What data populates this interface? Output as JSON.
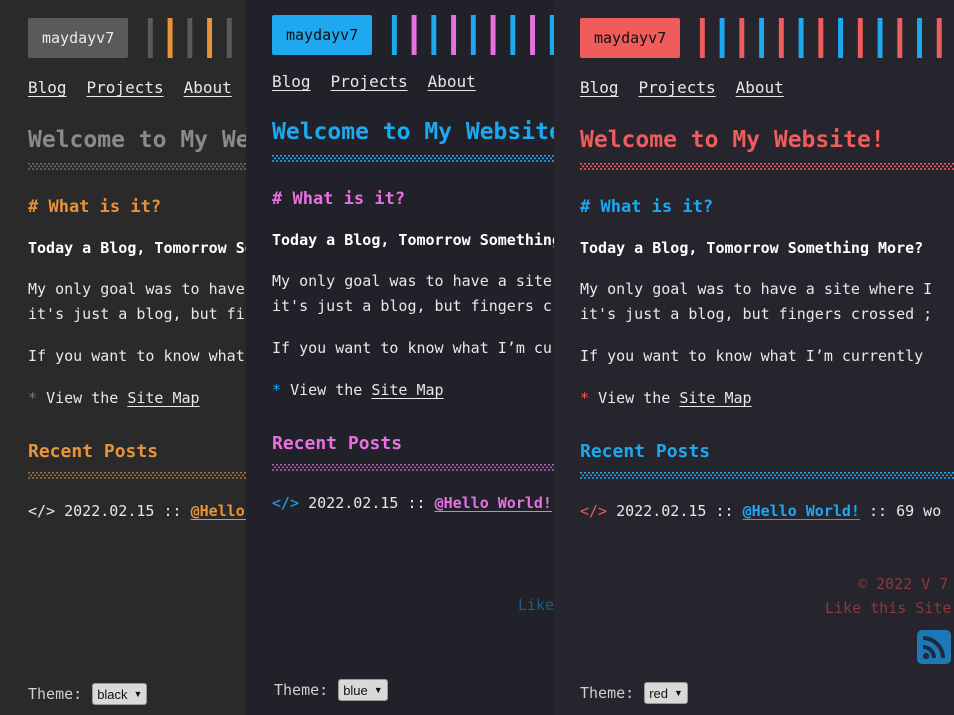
{
  "brand": "maydayv7",
  "nav": [
    "Blog",
    "Projects",
    "About"
  ],
  "welcome": "Welcome to My Website!",
  "section_heading": "# What is it?",
  "tagline": "Today a Blog, Tomorrow Something More?",
  "para_line1": "My only goal was to have a site where I",
  "para_line2": "it's just a blog, but fingers crossed ;",
  "para2": "If you want to know what I’m currently",
  "sitemap_prefix": "View the",
  "sitemap_link": "Site Map",
  "recent_posts": "Recent Posts",
  "post": {
    "icon": "</>",
    "date": "2022.02.15",
    "sep": "::",
    "link": "@Hello World!",
    "sep2": "::",
    "meta": "69 wo"
  },
  "footer": {
    "copyright": "© 2022 V 7",
    "like": "Like this Site"
  },
  "theme_label": "Theme:",
  "themes": [
    {
      "name": "black",
      "accent": "#e8933a",
      "title_color": "#8a8a8a",
      "logo_bg": "#5a5a5a",
      "logo_fg": "#eaeaea",
      "stripes": [
        "#5a5a5a",
        "#e8933a"
      ]
    },
    {
      "name": "blue",
      "accent": "#e870e0",
      "title_color": "#1ea8f0",
      "logo_bg": "#1ea8f0",
      "logo_fg": "#111111",
      "stripes": [
        "#1ea8f0",
        "#e870e0"
      ]
    },
    {
      "name": "red",
      "accent": "#1ea8f0",
      "title_color": "#ee5c5c",
      "logo_bg": "#ee5c5c",
      "logo_fg": "#111111",
      "stripes": [
        "#ee5c5c",
        "#1ea8f0"
      ]
    }
  ],
  "icons": {
    "star": "star-icon",
    "code": "code-icon",
    "rss": "rss-icon",
    "chevron": "chevron-down-icon"
  }
}
